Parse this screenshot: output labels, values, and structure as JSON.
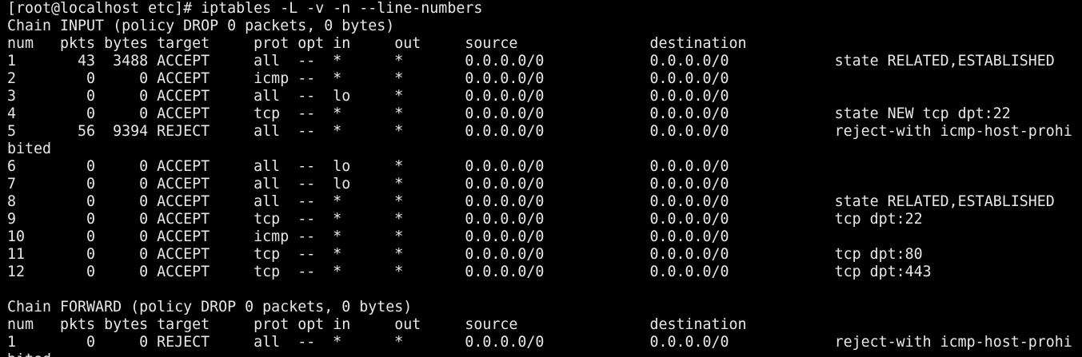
{
  "terminal": {
    "colors": {
      "background": "#000000",
      "foreground": "#e8e8e8"
    },
    "prompt": "[root@localhost etc]# ",
    "command": "iptables -L -v -n --line-numbers",
    "lines": [
      "Chain INPUT (policy DROP 0 packets, 0 bytes)",
      "num   pkts bytes target     prot opt in     out     source               destination",
      "1       43  3488 ACCEPT     all  --  *      *       0.0.0.0/0            0.0.0.0/0            state RELATED,ESTABLISHED",
      "2        0     0 ACCEPT     icmp --  *      *       0.0.0.0/0            0.0.0.0/0",
      "3        0     0 ACCEPT     all  --  lo     *       0.0.0.0/0            0.0.0.0/0",
      "4        0     0 ACCEPT     tcp  --  *      *       0.0.0.0/0            0.0.0.0/0            state NEW tcp dpt:22",
      "5       56  9394 REJECT     all  --  *      *       0.0.0.0/0            0.0.0.0/0            reject-with icmp-host-prohi",
      "bited",
      "6        0     0 ACCEPT     all  --  lo     *       0.0.0.0/0            0.0.0.0/0",
      "7        0     0 ACCEPT     all  --  lo     *       0.0.0.0/0            0.0.0.0/0",
      "8        0     0 ACCEPT     all  --  *      *       0.0.0.0/0            0.0.0.0/0            state RELATED,ESTABLISHED",
      "9        0     0 ACCEPT     tcp  --  *      *       0.0.0.0/0            0.0.0.0/0            tcp dpt:22",
      "10       0     0 ACCEPT     icmp --  *      *       0.0.0.0/0            0.0.0.0/0",
      "11       0     0 ACCEPT     tcp  --  *      *       0.0.0.0/0            0.0.0.0/0            tcp dpt:80",
      "12       0     0 ACCEPT     tcp  --  *      *       0.0.0.0/0            0.0.0.0/0            tcp dpt:443",
      "",
      "Chain FORWARD (policy DROP 0 packets, 0 bytes)",
      "num   pkts bytes target     prot opt in     out     source               destination",
      "1        0     0 REJECT     all  --  *      *       0.0.0.0/0            0.0.0.0/0            reject-with icmp-host-prohi",
      "bited"
    ]
  }
}
